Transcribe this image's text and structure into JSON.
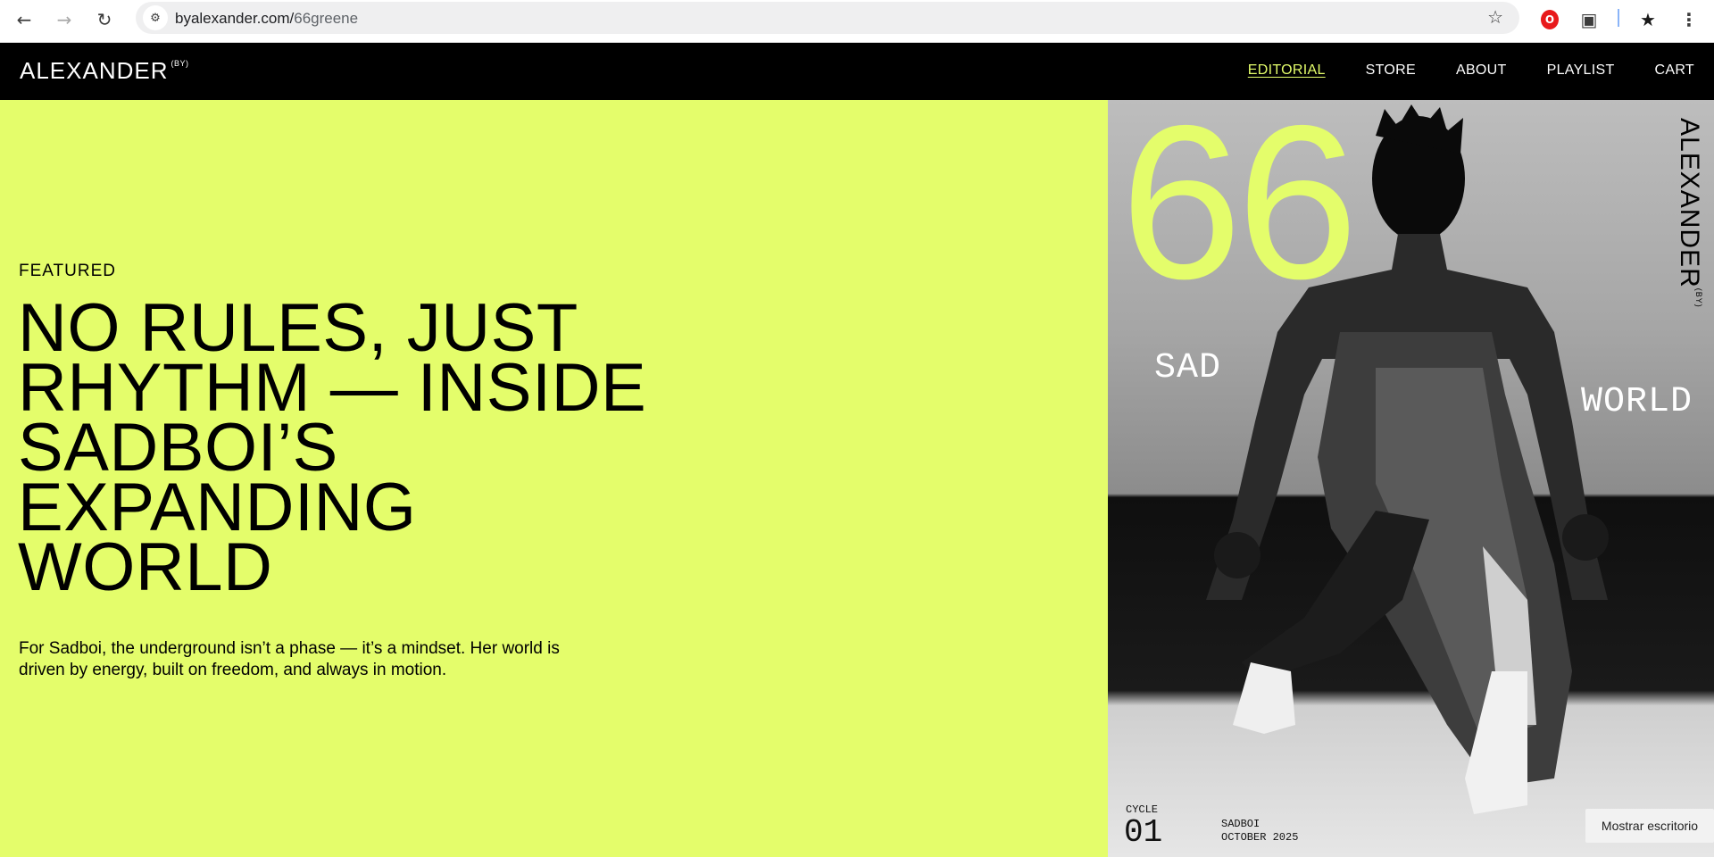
{
  "browser": {
    "url_domain": "byalexander.com/",
    "url_path": "66greene",
    "icons": [
      "back-arrow-icon",
      "forward-arrow-icon",
      "reload-icon",
      "site-info-icon",
      "bookmark-star-icon",
      "opera-extension-icon",
      "puzzle-extension-icon",
      "star-extension-icon",
      "menu-dots-icon"
    ]
  },
  "site": {
    "logo": "ALEXANDER",
    "logo_sup": "(BY)",
    "nav": [
      {
        "label": "EDITORIAL",
        "active": true
      },
      {
        "label": "STORE",
        "active": false
      },
      {
        "label": "ABOUT",
        "active": false
      },
      {
        "label": "PLAYLIST",
        "active": false
      },
      {
        "label": "CART",
        "active": false
      }
    ]
  },
  "hero": {
    "eyebrow": "FEATURED",
    "headline": "NO RULES, JUST RHYTHM — INSIDE SADBOI’S EXPANDING WORLD",
    "dek": "For Sadboi, the underground isn’t a phase — it’s a mindset. Her world is driven by energy, built on freedom, and always in motion."
  },
  "cover": {
    "number": "66",
    "left_word": "SAD",
    "right_word": "WORLD",
    "brand": "ALEXANDER",
    "brand_sup": "(BY)",
    "cycle_label": "CYCLE",
    "cycle_number": "01",
    "artist": "SADBOI",
    "date": "OCTOBER 2025"
  },
  "toast": "Mostrar escritorio",
  "colors": {
    "accent": "#e4fd6b",
    "header_bg": "#000000",
    "text": "#000000"
  }
}
